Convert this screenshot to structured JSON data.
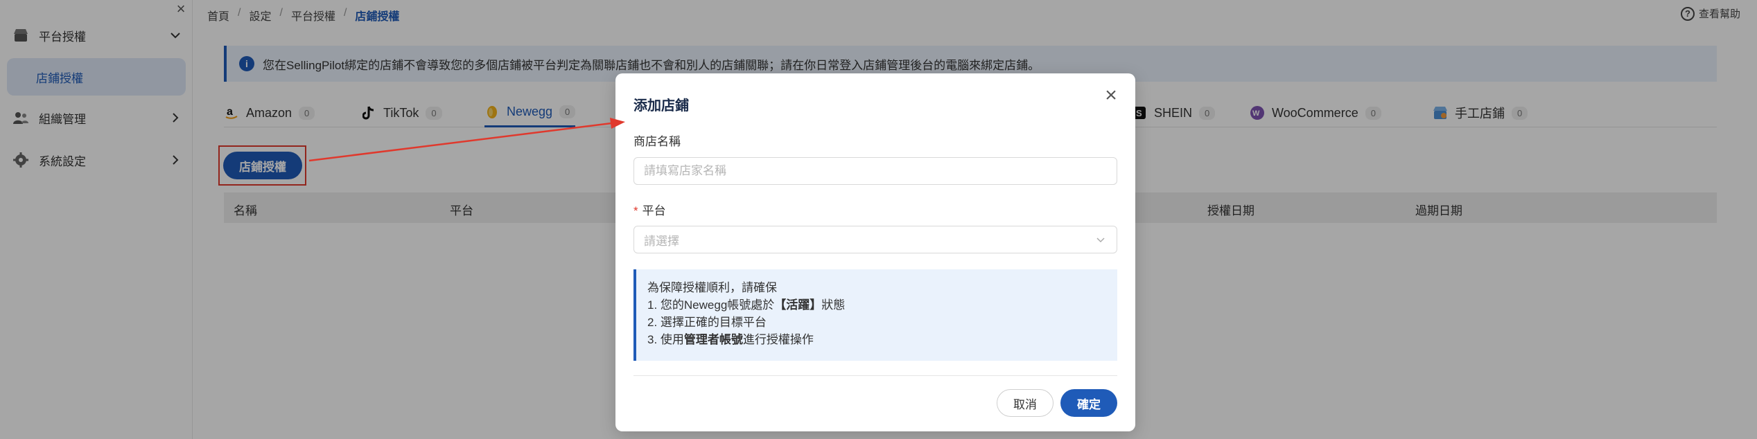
{
  "sidebar": {
    "groups": [
      {
        "label": "平台授權",
        "icon": "store-icon",
        "expanded": true
      },
      {
        "label": "組織管理",
        "icon": "people-icon",
        "expanded": false
      },
      {
        "label": "系統設定",
        "icon": "gear-icon",
        "expanded": false
      }
    ],
    "sub_item": "店鋪授權"
  },
  "breadcrumb": [
    "首頁",
    "設定",
    "平台授權",
    "店鋪授權"
  ],
  "help_label": "查看幫助",
  "notice": "您在SellingPilot綁定的店鋪不會導致您的多個店鋪被平台判定為關聯店鋪也不會和別人的店鋪關聯；請在你日常登入店鋪管理後台的電腦來綁定店鋪。",
  "tabs": [
    {
      "label": "Amazon",
      "count": "0",
      "icon": "amazon-icon"
    },
    {
      "label": "TikTok",
      "count": "0",
      "icon": "tiktok-icon"
    },
    {
      "label": "Newegg",
      "count": "0",
      "icon": "newegg-icon",
      "active": true
    },
    {
      "label": "SHEIN",
      "count": "0",
      "icon": "shein-icon"
    },
    {
      "label": "WooCommerce",
      "count": "0",
      "icon": "woocommerce-icon"
    },
    {
      "label": "手工店鋪",
      "count": "0",
      "icon": "manual-store-icon"
    }
  ],
  "auth_button": "店鋪授權",
  "table_headers": [
    "名稱",
    "平台",
    "授權日期",
    "過期日期"
  ],
  "modal": {
    "title": "添加店鋪",
    "store_name_label": "商店名稱",
    "store_name_placeholder": "請填寫店家名稱",
    "platform_label": "平台",
    "platform_placeholder": "請選擇",
    "tips_title": "為保障授權順利，請確保",
    "tip1_prefix": "1. 您的Newegg帳號處於",
    "tip1_bold": "【活躍】",
    "tip1_suffix": "狀態",
    "tip2": "2. 選擇正確的目標平台",
    "tip3_prefix": "3. 使用",
    "tip3_bold": "管理者帳號",
    "tip3_suffix": "進行授權操作",
    "cancel": "取消",
    "confirm": "確定"
  },
  "colors": {
    "primary": "#1f5bb8",
    "highlight": "#e0392d"
  }
}
